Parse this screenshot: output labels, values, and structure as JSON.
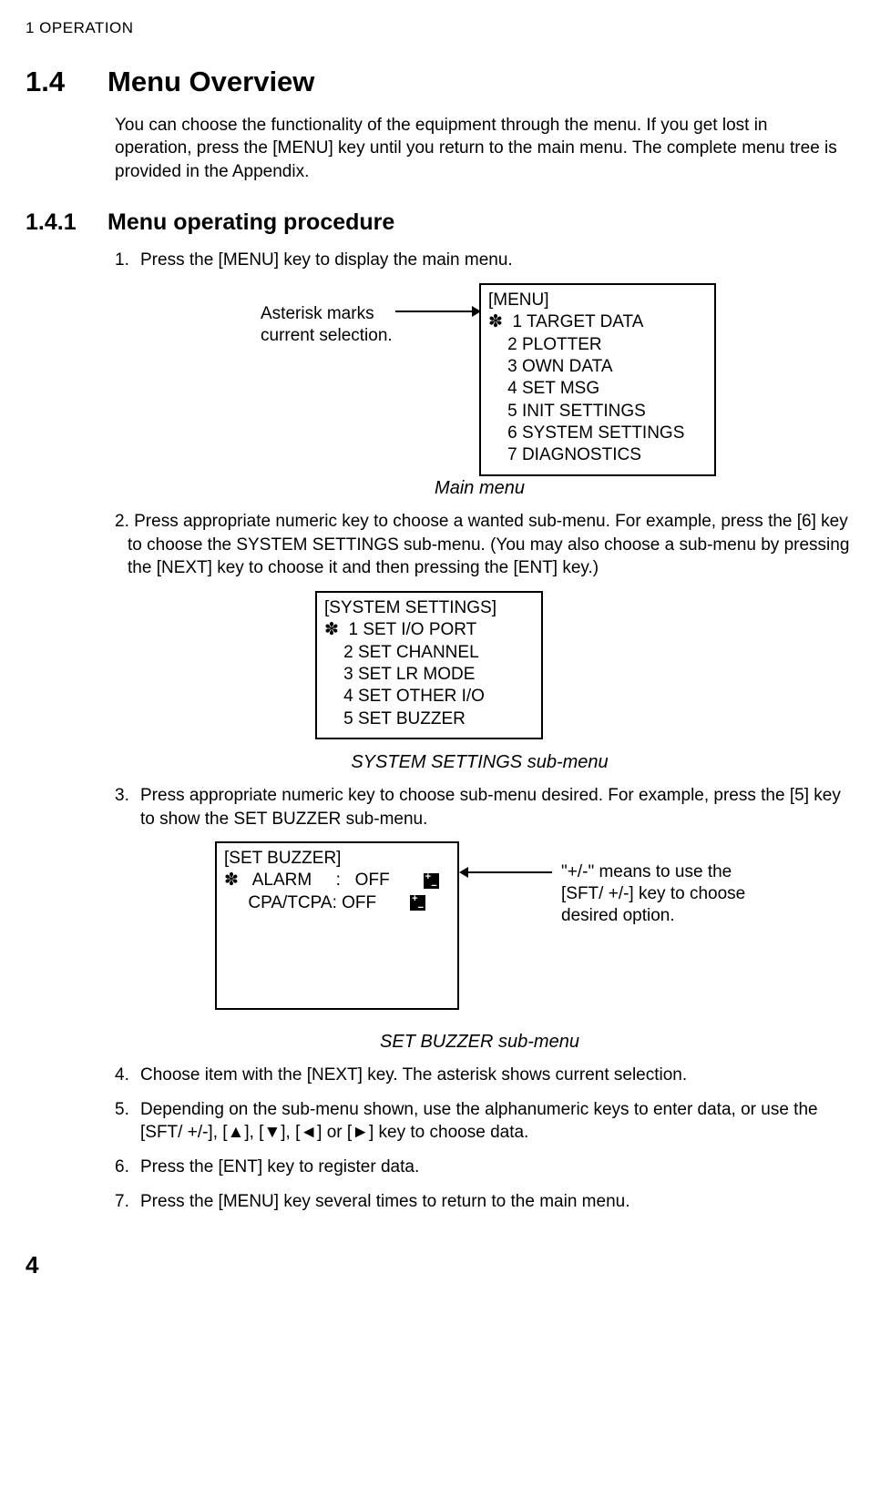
{
  "running_head": "1   OPERATION",
  "sec14": {
    "num": "1.4",
    "title": "Menu Overview"
  },
  "intro": "You can choose the functionality of the equipment through the menu. If you get lost in operation, press the [MENU] key until you return to the main menu. The complete menu tree is provided in the Appendix.",
  "sec141": {
    "num": "1.4.1",
    "title": "Menu operating procedure"
  },
  "step1": "Press the [MENU] key to display the main menu.",
  "fig1": {
    "note_l1": "Asterisk marks",
    "note_l2": "current selection.",
    "title": "[MENU]",
    "items": [
      "✽  1 TARGET DATA",
      "    2 PLOTTER",
      "    3 OWN DATA",
      "    4 SET MSG",
      "    5 INIT SETTINGS",
      "    6 SYSTEM SETTINGS",
      "    7 DIAGNOSTICS"
    ],
    "caption": "Main menu"
  },
  "step2": "2. Press appropriate numeric key to choose a wanted sub-menu. For example, press the [6] key to choose the SYSTEM SETTINGS sub-menu. (You may also choose a sub-menu by pressing the [NEXT] key to choose it and then pressing the [ENT] key.)",
  "fig2": {
    "title": "[SYSTEM SETTINGS]",
    "items": [
      "✽  1 SET I/O PORT",
      "    2 SET CHANNEL",
      "    3 SET LR MODE",
      "    4 SET OTHER I/O",
      "    5 SET BUZZER"
    ],
    "caption": "SYSTEM SETTINGS sub-menu"
  },
  "step3": "Press appropriate numeric key to choose sub-menu desired. For example, press the [5] key to show the SET BUZZER sub-menu.",
  "fig3": {
    "title": "[SET BUZZER]",
    "row1_left": "✽   ALARM     :   OFF",
    "row2_left": "     CPA/TCPA: OFF",
    "note_l1": "\"+/-\" means to use the",
    "note_l2": "[SFT/ +/-] key to choose",
    "note_l3": "desired option.",
    "caption": "SET BUZZER sub-menu"
  },
  "step4": "Choose item with the [NEXT] key. The asterisk shows current selection.",
  "step5": "Depending on the sub-menu shown, use the alphanumeric keys to enter data, or use the [SFT/ +/-], [▲], [▼], [◄] or [►] key to choose data.",
  "step6": "Press the [ENT] key to register data.",
  "step7": "Press the [MENU] key several times to return to the main menu.",
  "page_number": "4"
}
